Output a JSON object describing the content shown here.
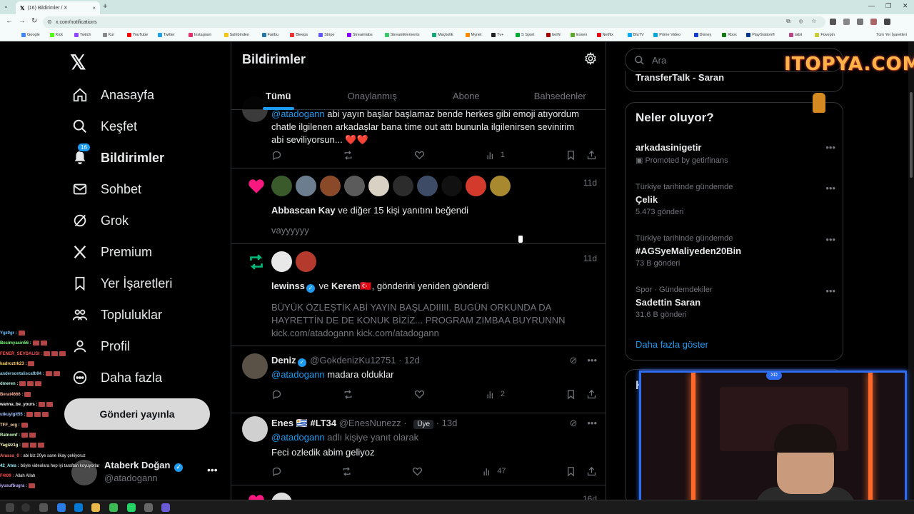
{
  "browser": {
    "tab_title": "(16) Bildirimler / X",
    "url": "x.com/notifications",
    "bookmarks": [
      "Google",
      "Kick",
      "Twitch",
      "Kur",
      "YouTube",
      "Twitter",
      "Instagram",
      "Sahibinden",
      "Faribu",
      "Bleeps",
      "Stripe",
      "Streamlabs",
      "StreamElements",
      "Maçkolik",
      "Mynet",
      "Tv+",
      "S Sport",
      "beIN",
      "Exxen",
      "Netflix",
      "BluTV",
      "Prime Video",
      "Disney",
      "Xbox",
      "PlayStation®",
      "tabii",
      "Fovepin"
    ],
    "bookmarks_right": "Tüm Yer İşaretleri"
  },
  "nav": {
    "items": [
      {
        "label": "Anasayfa",
        "icon": "home-icon"
      },
      {
        "label": "Keşfet",
        "icon": "search-icon"
      },
      {
        "label": "Bildirimler",
        "icon": "bell-icon",
        "badge": "16",
        "active": true
      },
      {
        "label": "Sohbet",
        "icon": "mail-icon"
      },
      {
        "label": "Grok",
        "icon": "grok-icon"
      },
      {
        "label": "Premium",
        "icon": "x-icon"
      },
      {
        "label": "Yer İşaretleri",
        "icon": "bookmark-icon"
      },
      {
        "label": "Topluluklar",
        "icon": "people-icon"
      },
      {
        "label": "Profil",
        "icon": "user-icon"
      },
      {
        "label": "Daha fazla",
        "icon": "more-circle-icon"
      }
    ],
    "post_button": "Gönderi yayınla",
    "profile": {
      "name": "Ataberk Doğan",
      "handle": "@atadogann"
    }
  },
  "chat": [
    {
      "user": "Ygz0gr :",
      "msg": "",
      "color": "#6ec6ff"
    },
    {
      "user": "Besimyasin56 :",
      "msg": "",
      "color": "#7fff7f"
    },
    {
      "user": "FENER_SEVDALISI :",
      "msg": "",
      "color": "#ff5555"
    },
    {
      "user": "kadroztrk23 :",
      "msg": "",
      "color": "#ffd166"
    },
    {
      "user": "andersontaliscafb94 :",
      "msg": "",
      "color": "#8ecae6"
    },
    {
      "user": "dmeren :",
      "msg": "",
      "color": "#b8f2e6"
    },
    {
      "user": "Berat4666 :",
      "msg": "",
      "color": "#ffb4a2"
    },
    {
      "user": "wanna_be_yours :",
      "msg": "",
      "color": "#ffffff"
    },
    {
      "user": "utkuyigit55 :",
      "msg": "",
      "color": "#a0c4ff"
    },
    {
      "user": "TFF_org :",
      "msg": "",
      "color": "#ffd6a5"
    },
    {
      "user": "Ratnomf :",
      "msg": "",
      "color": "#caffbf"
    },
    {
      "user": "Yagizz1g :",
      "msg": "",
      "color": "#fdffb6"
    },
    {
      "user": "Arasss_0 :",
      "msg": "abi biz 20ye sane ilkay çekiyoruz",
      "color": "#ff6b6b"
    },
    {
      "user": "42_Ates :",
      "msg": "böyle videolara hep iyi taraftan koyuyorlar",
      "color": "#9bf6ff"
    },
    {
      "user": "F4t09 :",
      "msg": "Allah Allah",
      "color": "#ff4d4d"
    },
    {
      "user": "iyusufbugra :",
      "msg": "",
      "color": "#bdb2ff"
    }
  ],
  "center": {
    "title": "Bildirimler",
    "tabs": [
      "Tümü",
      "Onaylanmış",
      "Abone",
      "Bahsedenler"
    ],
    "n1": {
      "mention": "@atadogann",
      "text_a": "abi yayın başlar başlamaz bende herkes gibi emoji atıyordum",
      "text_b": "chatle ilgilenen arkadaşlar bana time out attı bununla ilgilenirsen sevinirim",
      "text_c": "abi seviliyorsun... ❤️❤️",
      "views": "1"
    },
    "n2": {
      "time": "11d",
      "name": "Abbascan Kay",
      "rest": "ve diğer 15 kişi yanıtını beğendi",
      "snippet": "vayyyyyy"
    },
    "n3": {
      "time": "11d",
      "name1": "lewinss",
      "and": "ve",
      "name2": "Kerem🇹🇷",
      "rest": ", gönderini yeniden gönderdi",
      "body_a": "BÜYÜK ÖZLEŞTİK ABİ YAYIN BAŞLADIIIII. BUGÜN ORKUNDA DA",
      "body_b": "HAYRETTİN DE DE KONUK BİZİZ... PROGRAM ZIMBAA BUYRUNNN",
      "body_c": "kick.com/atadogann kick.com/atadogann"
    },
    "n4": {
      "name": "Deniz",
      "handle": "@GokdenizKu12751",
      "sep": "·",
      "time": "12d",
      "mention": "@atadogann",
      "text": "madara olduklar",
      "views": "2"
    },
    "n5": {
      "name": "Enes 🇺🇾 #LT34",
      "handle": "@EnesNunezz",
      "sep": "·",
      "role": "Üye",
      "time": "13d",
      "reply_mention": "@atadogann",
      "reply_rest": "adlı kişiye yanıt olarak",
      "text": "Feci ozledik abim geliyoz",
      "views": "47"
    },
    "n6": {
      "time": "16d"
    }
  },
  "right": {
    "search_placeholder": "Ara",
    "truncated_title": "TransferTalk - Saran",
    "trends_title": "Neler oluyor?",
    "trends": [
      {
        "context": "",
        "name": "arkadasinigetir",
        "count": "Promoted by getirfinans"
      },
      {
        "context": "Türkiye tarihinde gündemde",
        "name": "Çelik",
        "count": "5.473 gönderi"
      },
      {
        "context": "Türkiye tarihinde gündemde",
        "name": "#AGSyeMaliyeden20Bin",
        "count": "73 B gönderi"
      },
      {
        "context": "Spor · Gündemdekiler",
        "name": "Sadettin Saran",
        "count": "31,6 B gönderi"
      }
    ],
    "show_more": "Daha fazla göster",
    "k_card_title": "K"
  },
  "overlay": {
    "watermark": "ITOPYA.COM",
    "cam_badge": "XD"
  },
  "colors": {
    "accent": "#1d9bf0",
    "like": "#f91880",
    "retweet": "#00ba7c",
    "muted": "#71767b",
    "border": "#2f3336"
  }
}
